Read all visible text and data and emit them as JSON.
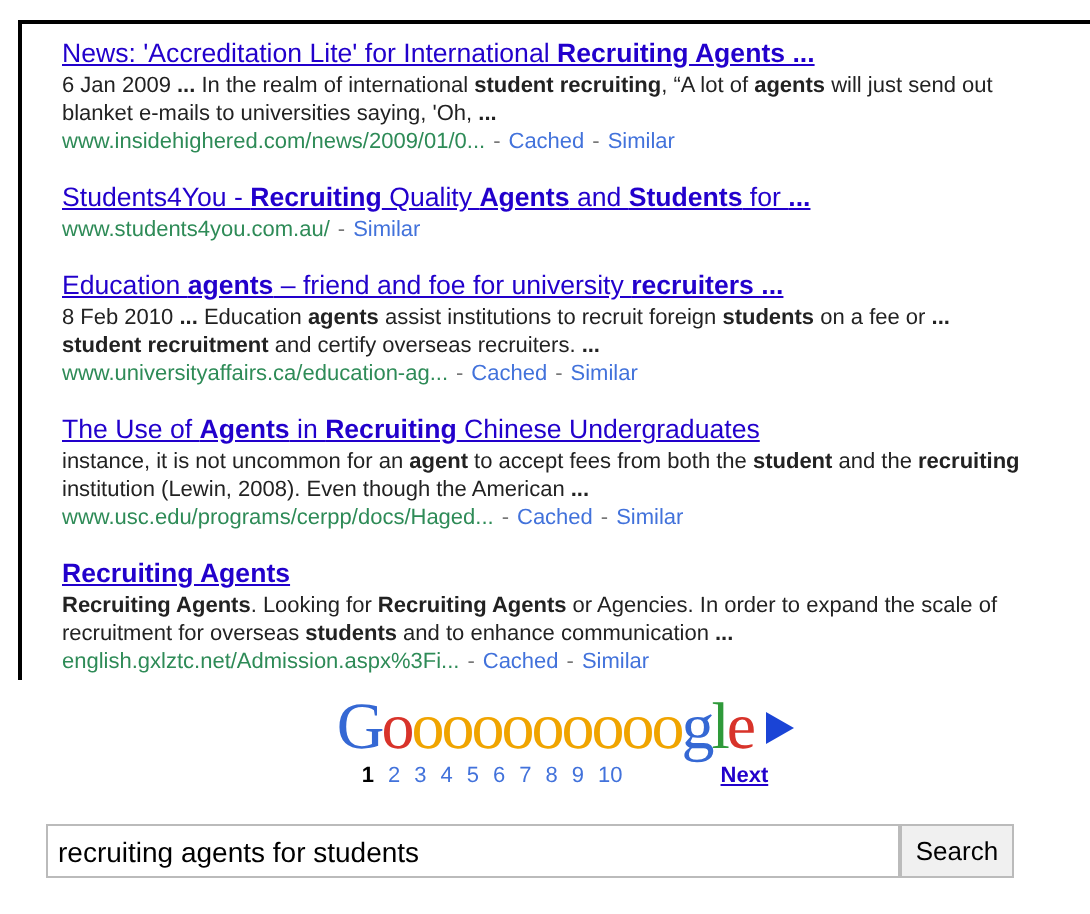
{
  "results": [
    {
      "title": "News: 'Accreditation Lite' for International **Recruiting Agents ...**",
      "snippet": "6 Jan 2009 **...** In the realm of international **student recruiting**, “A lot of **agents** will just send out blanket e-mails to universities saying, 'Oh, **...**",
      "url": "www.insidehighered.com/news/2009/01/0...",
      "separator": "-",
      "links": [
        "Cached",
        "Similar"
      ]
    },
    {
      "title": "Students4You - **Recruiting** Quality **Agents** and **Students** for **...**",
      "url": "www.students4you.com.au/",
      "separator": "-",
      "links": [
        "Similar"
      ]
    },
    {
      "title": "Education **agents** – friend and foe for university **recruiters ...**",
      "snippet": "8 Feb 2010 **...** Education **agents** assist institutions to recruit foreign **students** on a fee or **... student recruitment** and certify overseas recruiters. **...**",
      "url": "www.universityaffairs.ca/education-ag...",
      "separator": "-",
      "links": [
        "Cached",
        "Similar"
      ]
    },
    {
      "title": "The Use of **Agents** in **Recruiting** Chinese Undergraduates",
      "snippet": "instance, it is not uncommon for an **agent** to accept fees from both the **student** and the **recruiting** institution (Lewin, 2008). Even though the American **...**",
      "url": "www.usc.edu/programs/cerpp/docs/Haged...",
      "separator": "-",
      "links": [
        "Cached",
        "Similar"
      ]
    },
    {
      "title": "**Recruiting Agents**",
      "snippet": "**Recruiting Agents**. Looking for **Recruiting Agents** or Agencies. In order to expand the scale of recruitment for overseas **students** and to enhance communication **...**",
      "url": "english.gxlztc.net/Admission.aspx%3Fi...",
      "separator": "-",
      "links": [
        "Cached",
        "Similar"
      ]
    }
  ],
  "pager": {
    "logo": [
      {
        "text": "G",
        "color": "#3568d4"
      },
      {
        "text": "o",
        "color": "#d8332a"
      },
      {
        "text": "ooooooooo",
        "color": "#f0a400"
      },
      {
        "text": "g",
        "color": "#3568d4"
      },
      {
        "text": "l",
        "color": "#2f9a3a"
      },
      {
        "text": "e",
        "color": "#d8332a"
      }
    ],
    "pages": [
      {
        "label": "1",
        "selected": true
      },
      {
        "label": "2",
        "selected": false
      },
      {
        "label": "3",
        "selected": false
      },
      {
        "label": "4",
        "selected": false
      },
      {
        "label": "5",
        "selected": false
      },
      {
        "label": "6",
        "selected": false
      },
      {
        "label": "7",
        "selected": false
      },
      {
        "label": "8",
        "selected": false
      },
      {
        "label": "9",
        "selected": false
      },
      {
        "label": "10",
        "selected": false
      }
    ],
    "next": "Next"
  },
  "search": {
    "value": "recruiting agents for students",
    "button": "Search"
  }
}
